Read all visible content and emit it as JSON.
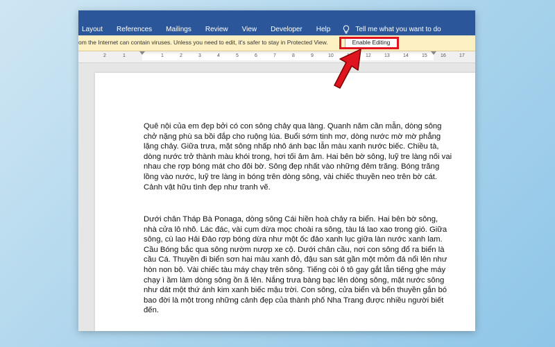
{
  "ribbon": {
    "tabs": [
      "Layout",
      "References",
      "Mailings",
      "Review",
      "View",
      "Developer",
      "Help"
    ],
    "tell_me": "Tell me what you want to do"
  },
  "message_bar": {
    "text": "om the Internet can contain viruses. Unless you need to edit, it's safer to stay in Protected View.",
    "button_label": "Enable Editing",
    "highlight_color": "#e0141e"
  },
  "ruler": {
    "left_labels": [
      "2",
      "1"
    ],
    "right_labels": [
      "1",
      "2",
      "3",
      "4",
      "5",
      "6",
      "7",
      "8",
      "9",
      "10",
      "11",
      "12",
      "13",
      "14",
      "15",
      "16",
      "17"
    ]
  },
  "document": {
    "paragraphs": [
      "Quê nội của em đẹp bởi có con sông chảy qua làng. Quanh năm cần mẫn, dòng sông chở nặng phù sa bồi đắp cho ruộng lúa. Buổi sớm tinh mơ, dòng nước mờ mờ phẳng lặng chảy. Giữa trưa, mặt sông nhấp nhô ánh bạc lẫn màu xanh nước biếc. Chiều tà, dòng nước trở thành màu khói trong, hơi tối âm âm. Hai bên bờ sông, luỹ tre làng nối vai nhau che rợp bóng mát cho đôi bờ. Sông đẹp nhất vào những đêm trăng. Bóng trăng lồng vào nước, luỹ tre làng in bóng trên dòng sông, vài chiếc thuyền neo trên bờ cát. Cảnh vật hữu tình đẹp như tranh vẽ.",
      "Dưới chân Tháp Bà Ponaga, dòng sông Cái hiền hoà chảy ra biển. Hai bên bờ sông, nhà cửa lô nhô. Lác đác, vài cụm dừa mọc choài ra sông, tàu lá lao xao trong gió. Giữa sông, cù lao Hải Đảo rợp bóng dừa như một ốc đảo xanh lục giữa làn nước xanh lam. Cầu Bóng bắc qua sông nườm nượp xe cộ. Dưới chân cầu, nơi con sông đổ ra biển là cầu Cá. Thuyền đi biển sơn hai màu xanh đỏ, đậu san sát gần một mỏm đá nổi lên như hòn non bộ. Vài chiếc tàu máy chạy trên sông. Tiếng còi ô tô gay gắt lẫn tiếng ghe máy chạy ì ầm làm dòng sông ồn ã lên. Nắng trưa bàng bạc lên dòng sông, mặt nước sông như dát một thứ ánh kim xanh biếc mậu trời. Con sông, cửa biển và bến thuyền gắn bó bao đời là một trong những cảnh đẹp của thành phố Nha Trang được nhiều người biết đến."
    ]
  },
  "colors": {
    "ribbon": "#2b579a",
    "message_bar": "#fdf1c3",
    "arrow": "#e0141e"
  }
}
